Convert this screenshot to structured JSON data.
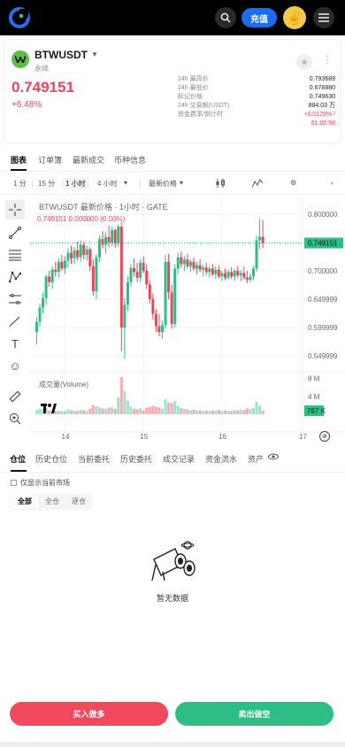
{
  "header": {
    "deposit_label": "充值",
    "avatar_emoji": "✌️"
  },
  "ticker": {
    "pair": "BTWUSDT",
    "type": "永续",
    "price": "0.749151",
    "change": "+6.48%",
    "stats": [
      {
        "label": "24h 最高价",
        "value": "0.793689",
        "color": "normal"
      },
      {
        "label": "24h 最低价",
        "value": "0.678880",
        "color": "normal"
      },
      {
        "label": "标记价格",
        "value": "0.749630",
        "color": "normal"
      },
      {
        "label": "24h 交易额(USDT)",
        "value": "884.03 万",
        "color": "normal"
      },
      {
        "label": "资金费率/倒计时",
        "value": "+0.0129% /",
        "color": "red"
      },
      {
        "label": "",
        "value": "01:02:58",
        "color": "red"
      }
    ]
  },
  "tabs": [
    "图表",
    "订单簿",
    "最新成交",
    "币种信息"
  ],
  "toolbar": {
    "intervals": [
      "1 分",
      "15 分",
      "1 小时",
      "4 小时"
    ],
    "price_type": "最新价格"
  },
  "chart_title": "BTWUSDT 最新价格 · 1小时 · GATE",
  "chart_ohlc": "0.749151  0.000000 (0.00%)",
  "volume_label": "成交量(Volume)",
  "chart_data": {
    "type": "candlestick",
    "title": "BTWUSDT 最新价格 · 1小时 · GATE",
    "y_ticks": [
      "0.800000",
      "0.749151",
      "0.700000",
      "0.649999",
      "0.599999",
      "0.549999"
    ],
    "y_tick_values": [
      0.8,
      0.749151,
      0.7,
      0.65,
      0.6,
      0.55
    ],
    "x_ticks": [
      "14",
      "15",
      "16",
      "17"
    ],
    "x_tick_values": [
      14,
      15,
      16,
      17
    ],
    "volume_ticks": [
      "8 M",
      "4 M",
      "767 K"
    ],
    "volume_tick_values": [
      8000000,
      4000000,
      767000
    ],
    "current_price": 0.749151,
    "candles": [
      {
        "t": 13.65,
        "o": 0.592,
        "h": 0.618,
        "l": 0.57,
        "c": 0.61,
        "v": 900000
      },
      {
        "t": 13.69,
        "o": 0.61,
        "h": 0.642,
        "l": 0.602,
        "c": 0.635,
        "v": 1200000
      },
      {
        "t": 13.73,
        "o": 0.635,
        "h": 0.662,
        "l": 0.625,
        "c": 0.652,
        "v": 1000000
      },
      {
        "t": 13.77,
        "o": 0.652,
        "h": 0.693,
        "l": 0.64,
        "c": 0.69,
        "v": 1400000
      },
      {
        "t": 13.81,
        "o": 0.69,
        "h": 0.7,
        "l": 0.672,
        "c": 0.68,
        "v": 800000
      },
      {
        "t": 13.85,
        "o": 0.68,
        "h": 0.708,
        "l": 0.668,
        "c": 0.702,
        "v": 900000
      },
      {
        "t": 13.89,
        "o": 0.702,
        "h": 0.716,
        "l": 0.69,
        "c": 0.698,
        "v": 700000
      },
      {
        "t": 13.93,
        "o": 0.698,
        "h": 0.722,
        "l": 0.688,
        "c": 0.716,
        "v": 800000
      },
      {
        "t": 13.97,
        "o": 0.716,
        "h": 0.728,
        "l": 0.7,
        "c": 0.704,
        "v": 600000
      },
      {
        "t": 14.01,
        "o": 0.704,
        "h": 0.726,
        "l": 0.694,
        "c": 0.718,
        "v": 700000
      },
      {
        "t": 14.05,
        "o": 0.718,
        "h": 0.74,
        "l": 0.706,
        "c": 0.732,
        "v": 1100000
      },
      {
        "t": 14.09,
        "o": 0.732,
        "h": 0.744,
        "l": 0.712,
        "c": 0.722,
        "v": 900000
      },
      {
        "t": 14.13,
        "o": 0.722,
        "h": 0.742,
        "l": 0.712,
        "c": 0.736,
        "v": 800000
      },
      {
        "t": 14.17,
        "o": 0.736,
        "h": 0.752,
        "l": 0.718,
        "c": 0.724,
        "v": 700000
      },
      {
        "t": 14.21,
        "o": 0.724,
        "h": 0.754,
        "l": 0.716,
        "c": 0.746,
        "v": 1000000
      },
      {
        "t": 14.25,
        "o": 0.746,
        "h": 0.752,
        "l": 0.72,
        "c": 0.728,
        "v": 900000
      },
      {
        "t": 14.29,
        "o": 0.728,
        "h": 0.744,
        "l": 0.718,
        "c": 0.738,
        "v": 700000
      },
      {
        "t": 14.33,
        "o": 0.738,
        "h": 0.742,
        "l": 0.7,
        "c": 0.708,
        "v": 1200000
      },
      {
        "t": 14.37,
        "o": 0.708,
        "h": 0.72,
        "l": 0.656,
        "c": 0.664,
        "v": 2000000
      },
      {
        "t": 14.41,
        "o": 0.664,
        "h": 0.73,
        "l": 0.65,
        "c": 0.724,
        "v": 1800000
      },
      {
        "t": 14.45,
        "o": 0.724,
        "h": 0.762,
        "l": 0.716,
        "c": 0.756,
        "v": 1500000
      },
      {
        "t": 14.49,
        "o": 0.756,
        "h": 0.77,
        "l": 0.74,
        "c": 0.746,
        "v": 1300000
      },
      {
        "t": 14.53,
        "o": 0.746,
        "h": 0.768,
        "l": 0.73,
        "c": 0.76,
        "v": 1200000
      },
      {
        "t": 14.57,
        "o": 0.76,
        "h": 0.78,
        "l": 0.742,
        "c": 0.75,
        "v": 1400000
      },
      {
        "t": 14.61,
        "o": 0.75,
        "h": 0.778,
        "l": 0.744,
        "c": 0.772,
        "v": 1600000
      },
      {
        "t": 14.65,
        "o": 0.772,
        "h": 0.775,
        "l": 0.74,
        "c": 0.748,
        "v": 1200000
      },
      {
        "t": 14.69,
        "o": 0.748,
        "h": 0.782,
        "l": 0.742,
        "c": 0.778,
        "v": 3800000
      },
      {
        "t": 14.73,
        "o": 0.778,
        "h": 0.786,
        "l": 0.558,
        "c": 0.6,
        "v": 8300000
      },
      {
        "t": 14.77,
        "o": 0.6,
        "h": 0.652,
        "l": 0.545,
        "c": 0.64,
        "v": 5200000
      },
      {
        "t": 14.81,
        "o": 0.64,
        "h": 0.69,
        "l": 0.63,
        "c": 0.68,
        "v": 3000000
      },
      {
        "t": 14.85,
        "o": 0.68,
        "h": 0.712,
        "l": 0.672,
        "c": 0.705,
        "v": 1700000
      },
      {
        "t": 14.89,
        "o": 0.705,
        "h": 0.722,
        "l": 0.69,
        "c": 0.698,
        "v": 1200000
      },
      {
        "t": 14.93,
        "o": 0.698,
        "h": 0.714,
        "l": 0.68,
        "c": 0.688,
        "v": 1100000
      },
      {
        "t": 14.97,
        "o": 0.688,
        "h": 0.72,
        "l": 0.68,
        "c": 0.714,
        "v": 1300000
      },
      {
        "t": 15.01,
        "o": 0.714,
        "h": 0.726,
        "l": 0.696,
        "c": 0.7,
        "v": 900000
      },
      {
        "t": 15.05,
        "o": 0.7,
        "h": 0.712,
        "l": 0.668,
        "c": 0.676,
        "v": 1500000
      },
      {
        "t": 15.09,
        "o": 0.676,
        "h": 0.684,
        "l": 0.642,
        "c": 0.65,
        "v": 1600000
      },
      {
        "t": 15.13,
        "o": 0.65,
        "h": 0.66,
        "l": 0.614,
        "c": 0.624,
        "v": 1900000
      },
      {
        "t": 15.17,
        "o": 0.624,
        "h": 0.632,
        "l": 0.592,
        "c": 0.602,
        "v": 1700000
      },
      {
        "t": 15.21,
        "o": 0.602,
        "h": 0.624,
        "l": 0.584,
        "c": 0.592,
        "v": 1500000
      },
      {
        "t": 15.25,
        "o": 0.592,
        "h": 0.612,
        "l": 0.58,
        "c": 0.604,
        "v": 1200000
      },
      {
        "t": 15.29,
        "o": 0.604,
        "h": 0.728,
        "l": 0.598,
        "c": 0.716,
        "v": 3300000
      },
      {
        "t": 15.33,
        "o": 0.716,
        "h": 0.73,
        "l": 0.65,
        "c": 0.662,
        "v": 2600000
      },
      {
        "t": 15.37,
        "o": 0.662,
        "h": 0.676,
        "l": 0.598,
        "c": 0.606,
        "v": 2500000
      },
      {
        "t": 15.41,
        "o": 0.606,
        "h": 0.712,
        "l": 0.6,
        "c": 0.704,
        "v": 2900000
      },
      {
        "t": 15.45,
        "o": 0.704,
        "h": 0.732,
        "l": 0.694,
        "c": 0.724,
        "v": 1800000
      },
      {
        "t": 15.49,
        "o": 0.724,
        "h": 0.734,
        "l": 0.706,
        "c": 0.712,
        "v": 1400000
      },
      {
        "t": 15.53,
        "o": 0.712,
        "h": 0.726,
        "l": 0.7,
        "c": 0.72,
        "v": 1200000
      },
      {
        "t": 15.57,
        "o": 0.72,
        "h": 0.73,
        "l": 0.704,
        "c": 0.708,
        "v": 1100000
      },
      {
        "t": 15.61,
        "o": 0.708,
        "h": 0.72,
        "l": 0.698,
        "c": 0.716,
        "v": 900000
      },
      {
        "t": 15.65,
        "o": 0.716,
        "h": 0.724,
        "l": 0.7,
        "c": 0.704,
        "v": 1000000
      },
      {
        "t": 15.69,
        "o": 0.704,
        "h": 0.716,
        "l": 0.694,
        "c": 0.71,
        "v": 800000
      },
      {
        "t": 15.73,
        "o": 0.71,
        "h": 0.72,
        "l": 0.698,
        "c": 0.702,
        "v": 900000
      },
      {
        "t": 15.77,
        "o": 0.702,
        "h": 0.71,
        "l": 0.69,
        "c": 0.706,
        "v": 700000
      },
      {
        "t": 15.81,
        "o": 0.706,
        "h": 0.714,
        "l": 0.692,
        "c": 0.698,
        "v": 800000
      },
      {
        "t": 15.85,
        "o": 0.698,
        "h": 0.708,
        "l": 0.688,
        "c": 0.704,
        "v": 700000
      },
      {
        "t": 15.89,
        "o": 0.704,
        "h": 0.712,
        "l": 0.69,
        "c": 0.694,
        "v": 900000
      },
      {
        "t": 15.93,
        "o": 0.694,
        "h": 0.708,
        "l": 0.686,
        "c": 0.702,
        "v": 800000
      },
      {
        "t": 15.97,
        "o": 0.702,
        "h": 0.71,
        "l": 0.686,
        "c": 0.69,
        "v": 1000000
      },
      {
        "t": 16.01,
        "o": 0.69,
        "h": 0.7,
        "l": 0.682,
        "c": 0.696,
        "v": 700000
      },
      {
        "t": 16.05,
        "o": 0.696,
        "h": 0.704,
        "l": 0.684,
        "c": 0.688,
        "v": 900000
      },
      {
        "t": 16.09,
        "o": 0.688,
        "h": 0.702,
        "l": 0.684,
        "c": 0.698,
        "v": 800000
      },
      {
        "t": 16.13,
        "o": 0.698,
        "h": 0.706,
        "l": 0.686,
        "c": 0.69,
        "v": 700000
      },
      {
        "t": 16.17,
        "o": 0.69,
        "h": 0.704,
        "l": 0.682,
        "c": 0.7,
        "v": 900000
      },
      {
        "t": 16.21,
        "o": 0.7,
        "h": 0.708,
        "l": 0.688,
        "c": 0.692,
        "v": 800000
      },
      {
        "t": 16.25,
        "o": 0.692,
        "h": 0.702,
        "l": 0.682,
        "c": 0.696,
        "v": 1000000
      },
      {
        "t": 16.29,
        "o": 0.696,
        "h": 0.708,
        "l": 0.684,
        "c": 0.688,
        "v": 900000
      },
      {
        "t": 16.33,
        "o": 0.688,
        "h": 0.7,
        "l": 0.678,
        "c": 0.684,
        "v": 1300000
      },
      {
        "t": 16.37,
        "o": 0.684,
        "h": 0.696,
        "l": 0.68,
        "c": 0.69,
        "v": 1100000
      },
      {
        "t": 16.41,
        "o": 0.69,
        "h": 0.708,
        "l": 0.684,
        "c": 0.704,
        "v": 1400000
      },
      {
        "t": 16.45,
        "o": 0.704,
        "h": 0.762,
        "l": 0.698,
        "c": 0.754,
        "v": 2800000
      },
      {
        "t": 16.49,
        "o": 0.754,
        "h": 0.792,
        "l": 0.738,
        "c": 0.76,
        "v": 1900000
      },
      {
        "t": 16.53,
        "o": 0.76,
        "h": 0.79,
        "l": 0.74,
        "c": 0.749151,
        "v": 767000
      }
    ]
  },
  "positions": {
    "tabs": [
      "仓位",
      "历史仓位",
      "当前委托",
      "历史委托",
      "成交记录",
      "资金流水",
      "资产"
    ],
    "only_current_label": "仅显示当前市场",
    "filters": [
      "全部",
      "全仓",
      "逐仓"
    ],
    "empty_text": "暂无数据"
  },
  "actions": {
    "buy_label": "买入做多",
    "sell_label": "卖出做空"
  },
  "colors": {
    "up": "#2ebd85",
    "down": "#e8465c",
    "deposit": "#1c6cf2"
  }
}
